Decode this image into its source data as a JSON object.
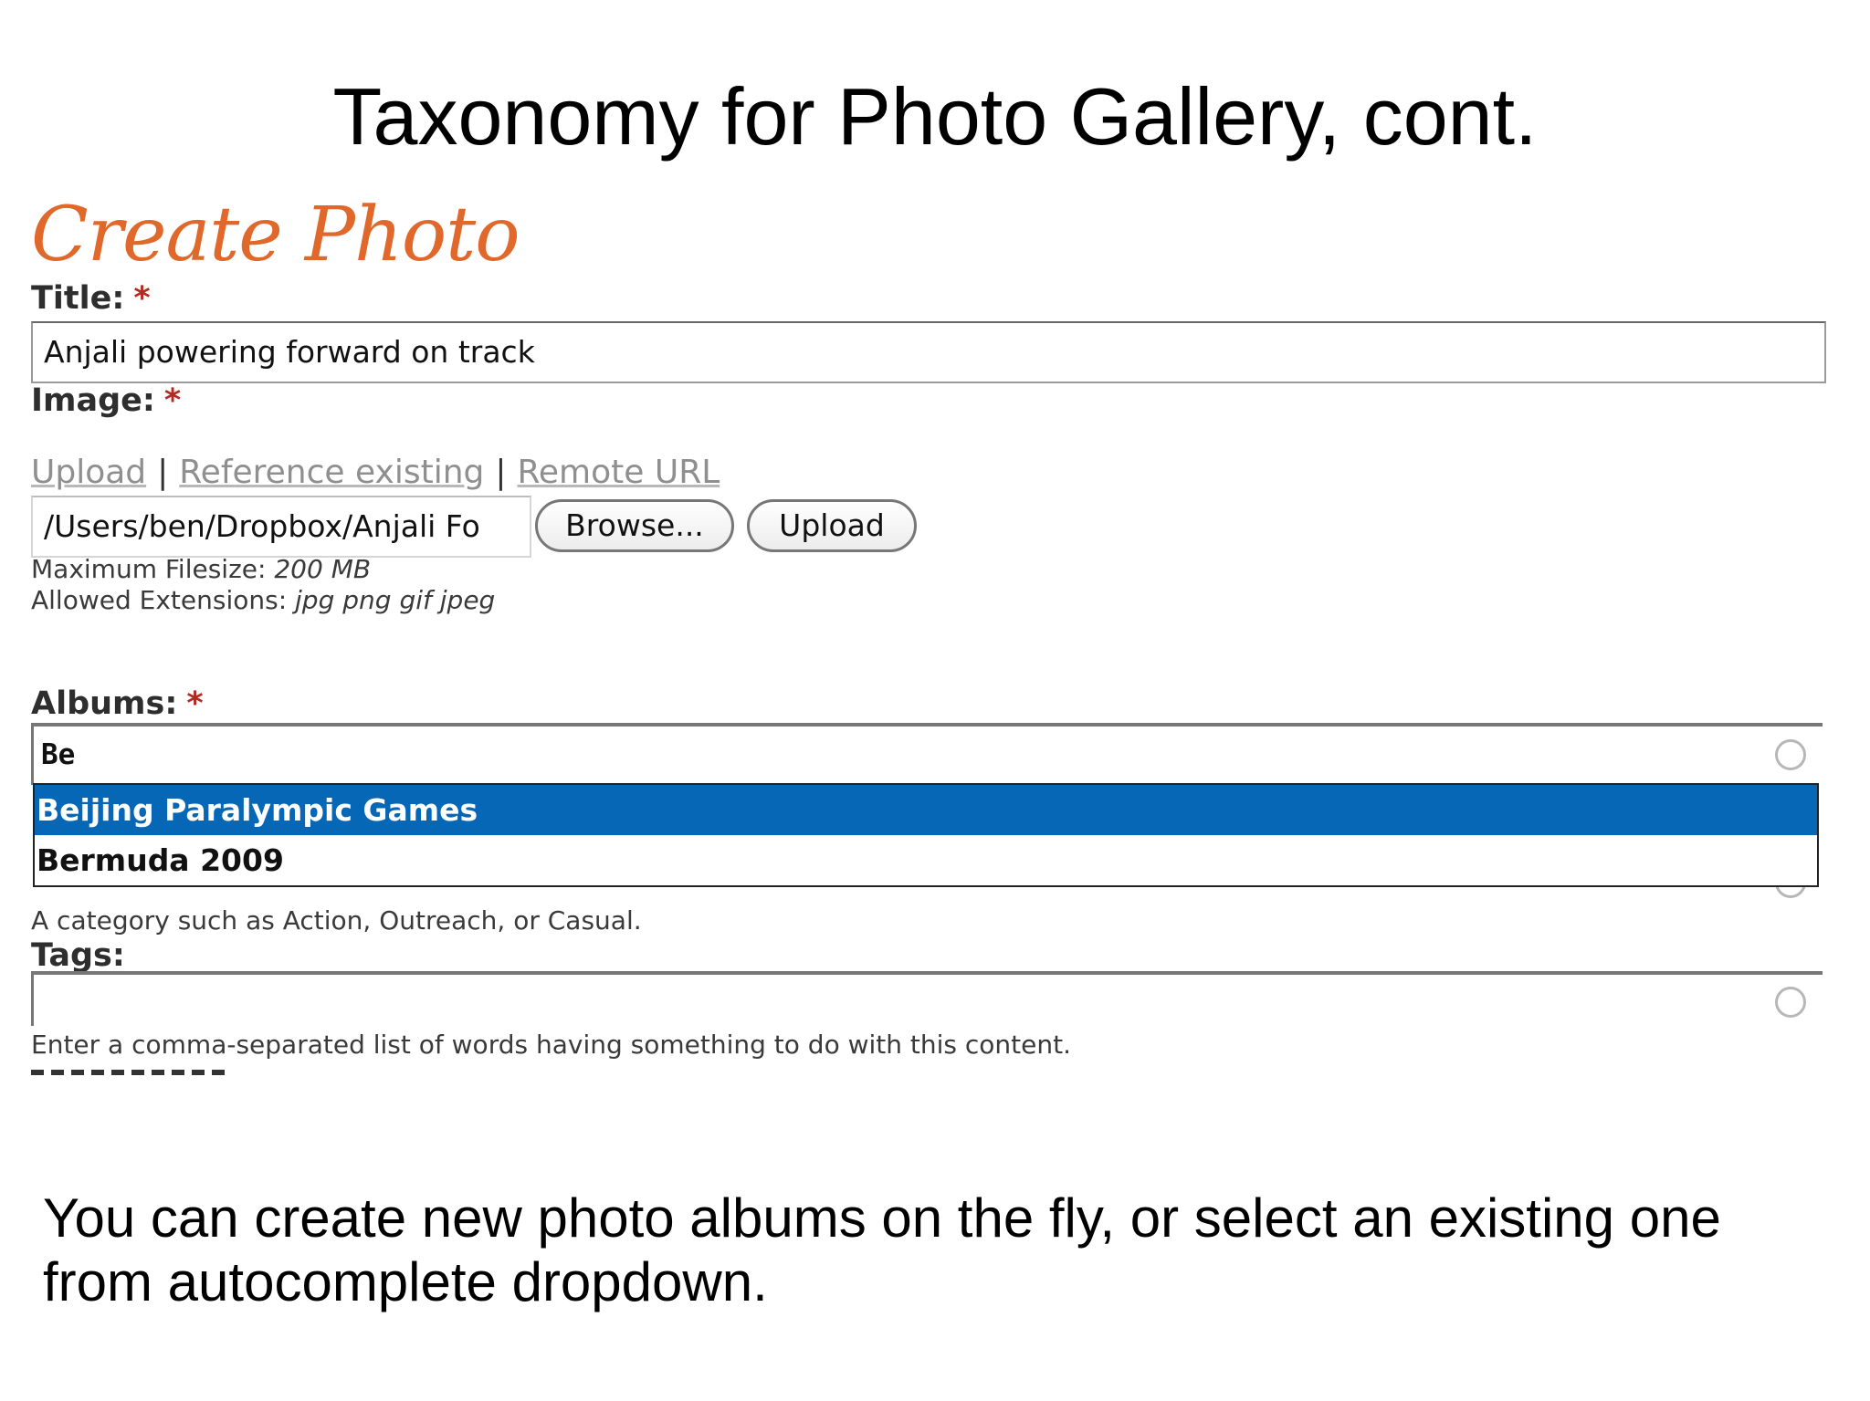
{
  "slide": {
    "title": "Taxonomy for Photo Gallery, cont.",
    "caption": "You can create new photo albums on the fly, or select an existing one from autocomplete dropdown."
  },
  "form": {
    "heading": "Create Photo",
    "required_marker": "*",
    "title_label": "Title:",
    "title_value": "Anjali powering forward on track",
    "image_label": "Image:",
    "image_tabs": [
      "Upload",
      "Reference existing",
      "Remote URL"
    ],
    "tab_separator": "|",
    "file_path_value": "/Users/ben/Dropbox/Anjali Fo",
    "browse_button": "Browse...",
    "upload_button": "Upload",
    "max_filesize_label": "Maximum Filesize:",
    "max_filesize_value": "200 MB",
    "allowed_extensions_label": "Allowed Extensions:",
    "allowed_extensions_value": "jpg png gif jpeg",
    "albums_label": "Albums:",
    "albums_value": "Be",
    "albums_suggestions": [
      {
        "label": "Beijing Paralympic Games",
        "selected": true
      },
      {
        "label": "Bermuda 2009",
        "selected": false
      }
    ],
    "albums_description": "A category such as Action, Outreach, or Casual.",
    "tags_label": "Tags:",
    "tags_value": "",
    "tags_description": "Enter a comma-separated list of words having something to do with this content."
  },
  "colors": {
    "heading": "#e0682b",
    "required": "#b42a22",
    "selected_suggestion": "#0667b6",
    "inactive_link": "#8f8f8f"
  },
  "icons": {
    "autocomplete_indicator": "throbber-icon"
  }
}
